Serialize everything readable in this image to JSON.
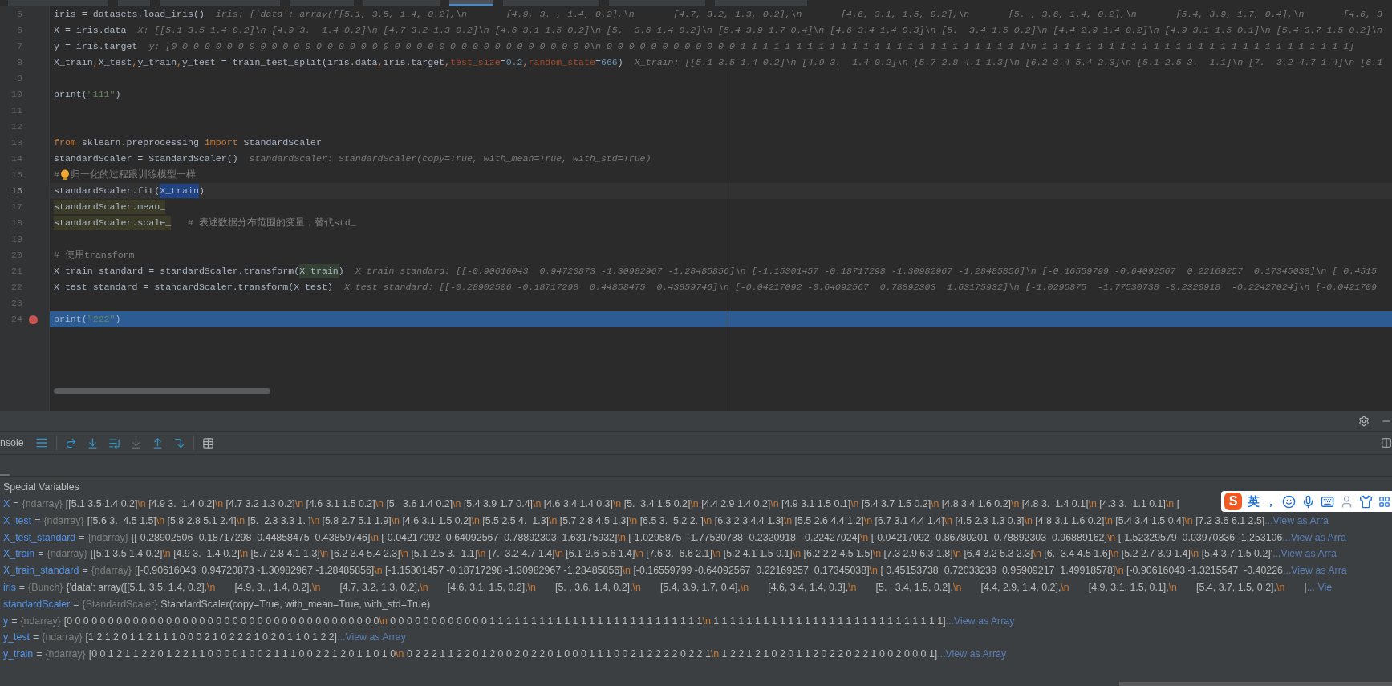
{
  "file_tabs": [
    {
      "selected": false
    },
    {
      "selected": false
    },
    {
      "selected": false
    },
    {
      "selected": false
    },
    {
      "selected": false
    },
    {
      "selected": true
    },
    {
      "selected": false
    },
    {
      "selected": false
    },
    {
      "selected": false
    }
  ],
  "editor": {
    "lines": [
      {
        "number": "5",
        "breakpoint": false,
        "current": false,
        "caret": false,
        "tokens": [
          {
            "kind": "plain",
            "text": "iris = datasets.load_iris()"
          }
        ],
        "hint": "iris: {'data': array([[5.1, 3.5, 1.4, 0.2],\\n       [4.9, 3. , 1.4, 0.2],\\n       [4.7, 3.2, 1.3, 0.2],\\n       [4.6, 3.1, 1.5, 0.2],\\n       [5. , 3.6, 1.4, 0.2],\\n       [5.4, 3.9, 1.7, 0.4],\\n       [4.6, 3"
      },
      {
        "number": "6",
        "breakpoint": false,
        "current": false,
        "caret": false,
        "tokens": [
          {
            "kind": "plain",
            "text": "X = iris.data"
          }
        ],
        "hint": "X: [[5.1 3.5 1.4 0.2]\\n [4.9 3.  1.4 0.2]\\n [4.7 3.2 1.3 0.2]\\n [4.6 3.1 1.5 0.2]\\n [5.  3.6 1.4 0.2]\\n [5.4 3.9 1.7 0.4]\\n [4.6 3.4 1.4 0.3]\\n [5.  3.4 1.5 0.2]\\n [4.4 2.9 1.4 0.2]\\n [4.9 3.1 1.5 0.1]\\n [5.4 3.7 1.5 0.2]\\n"
      },
      {
        "number": "7",
        "breakpoint": false,
        "current": false,
        "caret": false,
        "tokens": [
          {
            "kind": "plain",
            "text": "y = iris.target"
          }
        ],
        "hint": "y: [0 0 0 0 0 0 0 0 0 0 0 0 0 0 0 0 0 0 0 0 0 0 0 0 0 0 0 0 0 0 0 0 0 0 0 0 0 0\\n 0 0 0 0 0 0 0 0 0 0 0 0 1 1 1 1 1 1 1 1 1 1 1 1 1 1 1 1 1 1 1 1 1 1 1 1 1 1\\n 1 1 1 1 1 1 1 1 1 1 1 1 1 1 1 1 1 1 1 1 1 1 1 1 1 1 1 1]"
      },
      {
        "number": "8",
        "breakpoint": false,
        "current": false,
        "caret": false,
        "tokens": [
          {
            "kind": "plain",
            "text": "X_train"
          },
          {
            "kind": "keyword",
            "text": ","
          },
          {
            "kind": "plain",
            "text": "X_test"
          },
          {
            "kind": "keyword",
            "text": ","
          },
          {
            "kind": "plain",
            "text": "y_train"
          },
          {
            "kind": "keyword",
            "text": ","
          },
          {
            "kind": "plain",
            "text": "y_test = train_test_split(iris.data"
          },
          {
            "kind": "keyword",
            "text": ","
          },
          {
            "kind": "plain",
            "text": "iris.target"
          },
          {
            "kind": "keyword",
            "text": ","
          },
          {
            "kind": "param",
            "text": "test_size"
          },
          {
            "kind": "plain",
            "text": "="
          },
          {
            "kind": "number",
            "text": "0.2"
          },
          {
            "kind": "keyword",
            "text": ","
          },
          {
            "kind": "param",
            "text": "random_state"
          },
          {
            "kind": "plain",
            "text": "="
          },
          {
            "kind": "number",
            "text": "666"
          },
          {
            "kind": "plain",
            "text": ")"
          }
        ],
        "hint": "X_train: [[5.1 3.5 1.4 0.2]\\n [4.9 3.  1.4 0.2]\\n [5.7 2.8 4.1 1.3]\\n [6.2 3.4 5.4 2.3]\\n [5.1 2.5 3.  1.1]\\n [7.  3.2 4.7 1.4]\\n [6.1"
      },
      {
        "number": "9",
        "breakpoint": false,
        "current": false,
        "caret": false
      },
      {
        "number": "10",
        "breakpoint": false,
        "current": false,
        "caret": false,
        "tokens": [
          {
            "kind": "plain",
            "text": "print("
          },
          {
            "kind": "string",
            "text": "\"111\""
          },
          {
            "kind": "plain",
            "text": ")"
          }
        ]
      },
      {
        "number": "11",
        "breakpoint": false,
        "current": false,
        "caret": false
      },
      {
        "number": "12",
        "breakpoint": false,
        "current": false,
        "caret": false
      },
      {
        "number": "13",
        "breakpoint": false,
        "current": false,
        "caret": false,
        "tokens": [
          {
            "kind": "keyword",
            "text": "from"
          },
          {
            "kind": "plain",
            "text": " sklearn.preprocessing "
          },
          {
            "kind": "keyword",
            "text": "import"
          },
          {
            "kind": "plain",
            "text": " StandardScaler"
          }
        ]
      },
      {
        "number": "14",
        "breakpoint": false,
        "current": false,
        "caret": false,
        "tokens": [
          {
            "kind": "plain",
            "text": "standardScaler = StandardScaler()"
          }
        ],
        "hint": "standardScaler: StandardScaler(copy=True, with_mean=True, with_std=True)"
      },
      {
        "number": "15",
        "breakpoint": false,
        "current": false,
        "caret": false,
        "tokens": [
          {
            "kind": "comment",
            "text": "#"
          },
          {
            "kind": "bulb"
          },
          {
            "kind": "comment",
            "text": "归一化的过程跟训练模型一样"
          }
        ]
      },
      {
        "number": "16",
        "breakpoint": false,
        "current": false,
        "caret": true,
        "tokens": [
          {
            "kind": "plain",
            "text": "standardScaler.fit("
          },
          {
            "kind": "selection",
            "text": "X_train"
          },
          {
            "kind": "plain",
            "text": ")"
          }
        ]
      },
      {
        "number": "17",
        "breakpoint": false,
        "current": false,
        "caret": false,
        "tokens": [
          {
            "kind": "usage",
            "text": "standardScaler.mean_"
          }
        ]
      },
      {
        "number": "18",
        "breakpoint": false,
        "current": false,
        "caret": false,
        "tokens": [
          {
            "kind": "usage",
            "text": "standardScaler.scale_"
          },
          {
            "kind": "comment",
            "text": "   # 表述数据分布范围的变量，替代std_"
          }
        ]
      },
      {
        "number": "19",
        "breakpoint": false,
        "current": false,
        "caret": false
      },
      {
        "number": "20",
        "breakpoint": false,
        "current": false,
        "caret": false,
        "tokens": [
          {
            "kind": "comment",
            "text": "# 使用transform"
          }
        ]
      },
      {
        "number": "21",
        "breakpoint": false,
        "current": false,
        "caret": false,
        "tokens": [
          {
            "kind": "plain",
            "text": "X_train_standard = standardScaler.transform("
          },
          {
            "kind": "read_usage",
            "text": "X_train"
          },
          {
            "kind": "plain",
            "text": ")"
          }
        ],
        "hint": "X_train_standard: [[-0.90616043  0.94720873 -1.30982967 -1.28485856]\\n [-1.15301457 -0.18717298 -1.30982967 -1.28485856]\\n [-0.16559799 -0.64092567  0.22169257  0.17345038]\\n [ 0.4515"
      },
      {
        "number": "22",
        "breakpoint": false,
        "current": false,
        "caret": false,
        "tokens": [
          {
            "kind": "plain",
            "text": "X_test_standard = standardScaler.transform(X_test)"
          }
        ],
        "hint": "X_test_standard: [[-0.28902506 -0.18717298  0.44858475  0.43859746]\\n [-0.04217092 -0.64092567  0.78892303  1.63175932]\\n [-1.0295875  -1.77530738 -0.2320918  -0.22427024]\\n [-0.0421709"
      },
      {
        "number": "23",
        "breakpoint": false,
        "current": false,
        "caret": false
      },
      {
        "number": "24",
        "breakpoint": true,
        "current": true,
        "caret": false,
        "tokens": [
          {
            "kind": "plain",
            "text": "print("
          },
          {
            "kind": "string",
            "text": "\"222\""
          },
          {
            "kind": "plain",
            "text": ")"
          }
        ]
      }
    ]
  },
  "debugger": {
    "console_tab": "nsole",
    "special_variables": "Special Variables",
    "variables": [
      {
        "name": "X",
        "eq": "=",
        "type": "{ndarray}",
        "value": "[[5.1 3.5 1.4 0.2]\\n [4.9 3.  1.4 0.2]\\n [4.7 3.2 1.3 0.2]\\n [4.6 3.1 1.5 0.2]\\n [5.  3.6 1.4 0.2]\\n [5.4 3.9 1.7 0.4]\\n [4.6 3.4 1.4 0.3]\\n [5.  3.4 1.5 0.2]\\n [4.4 2.9 1.4 0.2]\\n [4.9 3.1 1.5 0.1]\\n [5.4 3.7 1.5 0.2]\\n [4.8 3.4 1.6 0.2]\\n [4.8 3.  1.4 0.1]\\n [4.3 3.  1.1 0.1]\\n ["
      },
      {
        "name": "X_test",
        "eq": "=",
        "type": "{ndarray}",
        "value": "[[5.6 3.  4.5 1.5]\\n [5.8 2.8 5.1 2.4]\\n [5.  2.3 3.3 1. ]\\n [5.8 2.7 5.1 1.9]\\n [4.6 3.1 1.5 0.2]\\n [5.5 2.5 4.  1.3]\\n [5.7 2.8 4.5 1.3]\\n [6.5 3.  5.2 2. ]\\n [6.3 2.3 4.4 1.3]\\n [5.5 2.6 4.4 1.2]\\n [6.7 3.1 4.4 1.4]\\n [4.5 2.3 1.3 0.3]\\n [4.8 3.1 1.6 0.2]\\n [5.4 3.4 1.5 0.4]\\n [7.2 3.6 6.1 2.5]",
        "link": "...View as Arra"
      },
      {
        "name": "X_test_standard",
        "eq": "=",
        "type": "{ndarray}",
        "value": "[[-0.28902506 -0.18717298  0.44858475  0.43859746]\\n [-0.04217092 -0.64092567  0.78892303  1.63175932]\\n [-1.0295875  -1.77530738 -0.2320918  -0.22427024]\\n [-0.04217092 -0.86780201  0.78892303  0.96889162]\\n [-1.52329579  0.03970336 -1.253106",
        "link": "...View as Arra"
      },
      {
        "name": "X_train",
        "eq": "=",
        "type": "{ndarray}",
        "value": "[[5.1 3.5 1.4 0.2]\\n [4.9 3.  1.4 0.2]\\n [5.7 2.8 4.1 1.3]\\n [6.2 3.4 5.4 2.3]\\n [5.1 2.5 3.  1.1]\\n [7.  3.2 4.7 1.4]\\n [6.1 2.6 5.6 1.4]\\n [7.6 3.  6.6 2.1]\\n [5.2 4.1 1.5 0.1]\\n [6.2 2.2 4.5 1.5]\\n [7.3 2.9 6.3 1.8]\\n [6.4 3.2 5.3 2.3]\\n [6.  3.4 4.5 1.6]\\n [5.2 2.7 3.9 1.4]\\n [5.4 3.7 1.5 0.2]'",
        "link": "...View as Arra"
      },
      {
        "name": "X_train_standard",
        "eq": "=",
        "type": "{ndarray}",
        "value": "[[-0.90616043  0.94720873 -1.30982967 -1.28485856]\\n [-1.15301457 -0.18717298 -1.30982967 -1.28485856]\\n [-0.16559799 -0.64092567  0.22169257  0.17345038]\\n [ 0.45153738  0.72033239  0.95909217  1.49918578]\\n [-0.90616043 -1.3215547  -0.40226",
        "link": "...View as Arra"
      },
      {
        "name": "iris",
        "eq": "=",
        "type": "{Bunch}",
        "value": "{'data': array([[5.1, 3.5, 1.4, 0.2],\\n       [4.9, 3. , 1.4, 0.2],\\n       [4.7, 3.2, 1.3, 0.2],\\n       [4.6, 3.1, 1.5, 0.2],\\n       [5. , 3.6, 1.4, 0.2],\\n       [5.4, 3.9, 1.7, 0.4],\\n       [4.6, 3.4, 1.4, 0.3],\\n       [5. , 3.4, 1.5, 0.2],\\n       [4.4, 2.9, 1.4, 0.2],\\n       [4.9, 3.1, 1.5, 0.1],\\n       [5.4, 3.7, 1.5, 0.2],\\n       |",
        "link": "... Vie"
      },
      {
        "name": "standardScaler",
        "eq": "=",
        "type": "{StandardScaler}",
        "value": "StandardScaler(copy=True, with_mean=True, with_std=True)"
      },
      {
        "name": "y",
        "eq": "=",
        "type": "{ndarray}",
        "value": "[0 0 0 0 0 0 0 0 0 0 0 0 0 0 0 0 0 0 0 0 0 0 0 0 0 0 0 0 0 0 0 0 0 0 0 0 0 0\\n 0 0 0 0 0 0 0 0 0 0 0 0 1 1 1 1 1 1 1 1 1 1 1 1 1 1 1 1 1 1 1 1 1 1 1 1 1 1\\n 1 1 1 1 1 1 1 1 1 1 1 1 1 1 1 1 1 1 1 1 1 1 1 1 1 1 1 1]",
        "link": "...View as Array"
      },
      {
        "name": "y_test",
        "eq": "=",
        "type": "{ndarray}",
        "value": "[1 2 1 2 0 1 1 2 1 1 1 0 0 0 2 1 0 2 2 2 1 0 2 0 1 1 0 1 2 2]",
        "link": "...View as Array"
      },
      {
        "name": "y_train",
        "eq": "=",
        "type": "{ndarray}",
        "value": "[0 0 1 2 1 1 2 2 0 1 2 2 1 1 0 0 0 0 1 0 0 2 1 1 1 0 0 2 2 1 2 0 1 1 0 1 0\\n 0 2 2 2 1 1 2 2 0 1 2 0 0 2 0 2 2 0 1 0 0 0 1 1 1 0 0 2 1 2 2 2 2 0 2 2 1\\n 1 2 2 1 2 1 0 2 0 1 1 2 0 2 2 0 2 2 1 0 0 2 0 0 0 1]",
        "link": "...View as Array"
      }
    ]
  },
  "ime_toolbar": {
    "logo": "S",
    "mode": "英",
    "punctuation": "，"
  }
}
